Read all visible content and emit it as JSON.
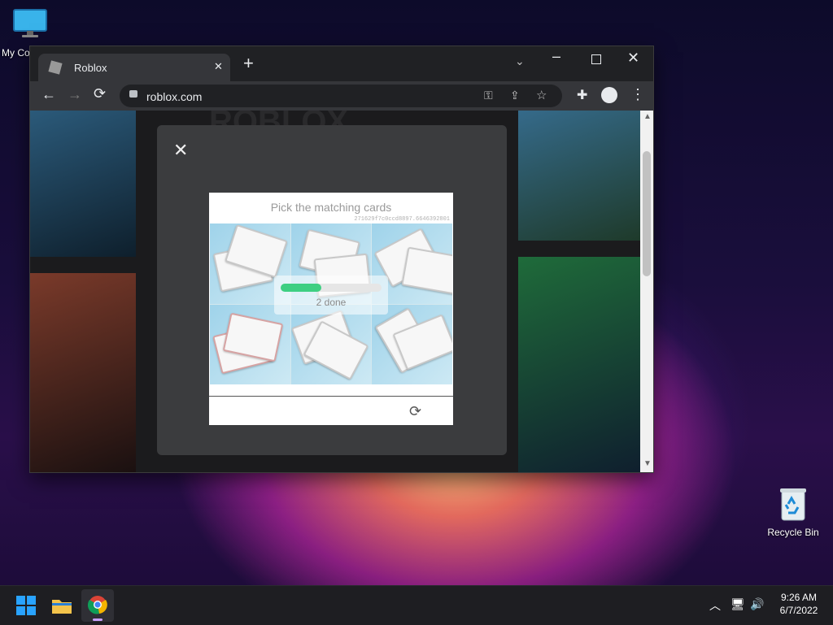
{
  "desktop": {
    "my_computer_label": "My Co",
    "recycle_bin_label": "Recycle Bin"
  },
  "browser": {
    "tab_title": "Roblox",
    "url": "roblox.com",
    "buttons": {
      "new_tab": "+",
      "close_tab": "✕"
    }
  },
  "captcha": {
    "title": "Pick the matching cards",
    "id_text": "271629f7c0ccd8897.6646392801",
    "progress_text": "2 done"
  },
  "tray": {
    "time": "9:26 AM",
    "date": "6/7/2022"
  }
}
